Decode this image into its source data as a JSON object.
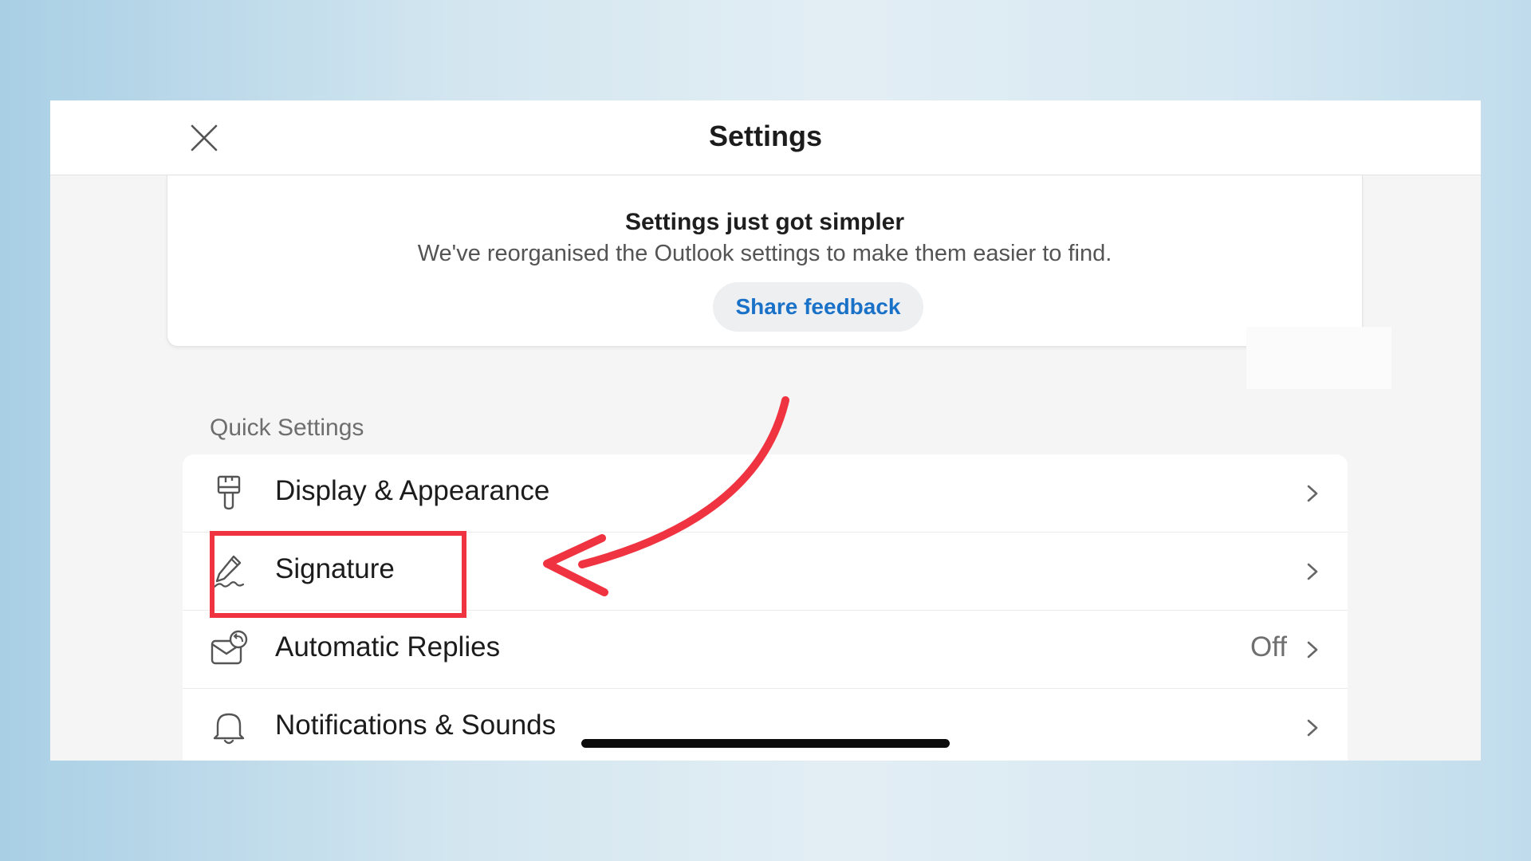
{
  "header": {
    "title": "Settings",
    "close_icon": "close-icon"
  },
  "banner": {
    "title": "Settings just got simpler",
    "subtitle": "We've reorganised the Outlook settings to make them easier to find.",
    "button_label": "Share feedback",
    "button_color": "#1a72c8"
  },
  "quick_settings": {
    "section_label": "Quick Settings",
    "items": [
      {
        "label": "Display & Appearance",
        "icon": "paintbrush-icon",
        "value": ""
      },
      {
        "label": "Signature",
        "icon": "signature-pen-icon",
        "value": ""
      },
      {
        "label": "Automatic Replies",
        "icon": "envelope-reply-icon",
        "value": "Off"
      },
      {
        "label": "Notifications & Sounds",
        "icon": "bell-icon",
        "value": ""
      }
    ]
  },
  "annotation": {
    "highlight_color": "#ef3340",
    "highlighted_item": "Signature"
  }
}
